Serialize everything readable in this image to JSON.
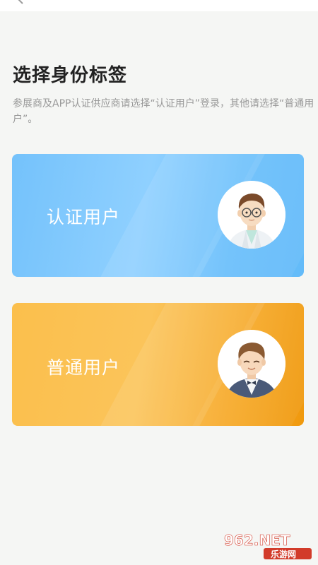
{
  "page": {
    "title": "选择身份标签",
    "description": "参展商及APP认证供应商请选择“认证用户”登录，其他请选择“普通用户”。"
  },
  "options": [
    {
      "label": "认证用户",
      "avatar": "doctor-avatar-icon",
      "color": "#74c2fb"
    },
    {
      "label": "普通用户",
      "avatar": "businessman-avatar-icon",
      "color": "#fbbf4c"
    }
  ],
  "watermark": {
    "logo": "962.NET",
    "subtitle": "乐游网"
  }
}
